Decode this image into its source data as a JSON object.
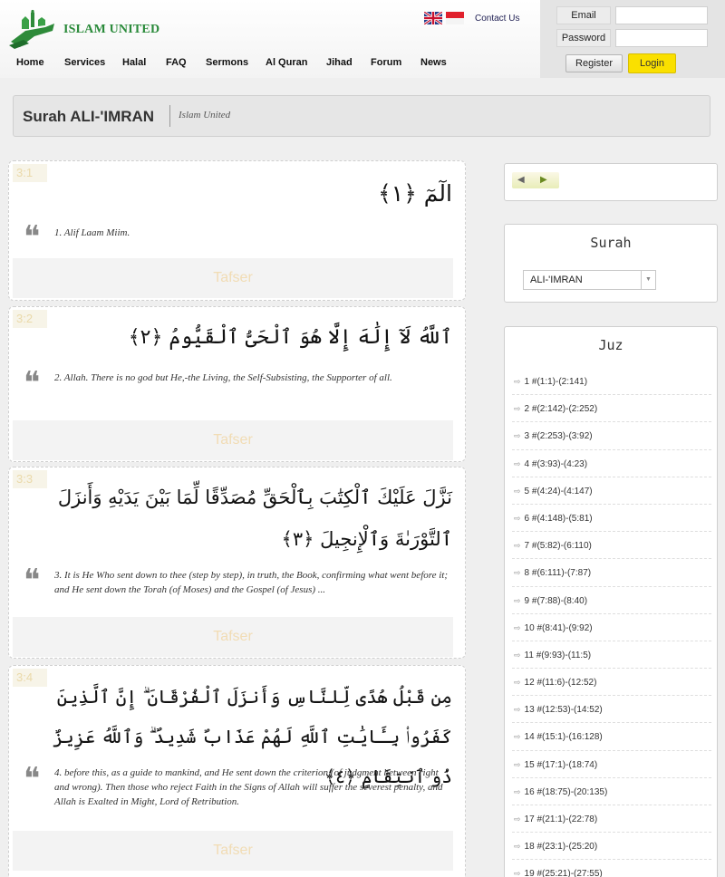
{
  "header": {
    "brand": "ISLAM UNITED",
    "contact": "Contact Us",
    "nav": [
      "Home",
      "Services",
      "Halal",
      "FAQ",
      "Sermons",
      "Al Quran",
      "Jihad",
      "Forum",
      "News"
    ]
  },
  "login": {
    "email_label": "Email",
    "password_label": "Password",
    "email_value": "",
    "password_value": "",
    "register": "Register",
    "login": "Login"
  },
  "title": {
    "main": "Surah ALI-'IMRAN",
    "sub": "Islam United"
  },
  "verses": [
    {
      "num": "3:1",
      "arabic": "الٓمٓ ﴿١﴾",
      "translation": "1. Alif Laam Miim.",
      "tafser": "Tafser"
    },
    {
      "num": "3:2",
      "arabic": "ٱللَّهُ لَآ إِلَٰهَ إِلَّا هُوَ ٱلْحَىُّ ٱلْقَيُّومُ ﴿٢﴾",
      "translation": "2. Allah. There is no god but He,-the Living, the Self-Subsisting, the Supporter of all.",
      "tafser": "Tafser"
    },
    {
      "num": "3:3",
      "arabic": "نَزَّلَ عَلَيْكَ ٱلْكِتَٰبَ بِٱلْحَقِّ مُصَدِّقًا لِّمَا بَيْنَ يَدَيْهِ وَأَنزَلَ ٱلتَّوْرَىٰةَ وَٱلْإِنجِيلَ ﴿٣﴾",
      "translation": "3. It is He Who sent down to thee (step by step), in truth, the Book, confirming what went before it; and He sent down the Torah (of Moses) and the Gospel (of Jesus) ...",
      "tafser": "Tafser"
    },
    {
      "num": "3:4",
      "arabic": "مِن قَبْلُ هُدًى لِّلنَّاسِ وَأَنزَلَ ٱلْفُرْقَانَ ۗ إِنَّ ٱلَّذِينَ كَفَرُوا۟ بِـَٔايَٰتِ ٱللَّهِ لَهُمْ عَذَابٌ شَدِيدٌ ۗ وَٱللَّهُ عَزِيزٌ ذُو ٱنتِقَامٍ ﴿٤﴾",
      "translation": "4. before this, as a guide to mankind, and He sent down the criterion (of judgment between right and wrong). Then those who reject Faith in the Signs of Allah will suffer the severest penalty, and Allah is Exalted in Might, Lord of Retribution.",
      "tafser": "Tafser"
    }
  ],
  "sidebar": {
    "surah_heading": "Surah",
    "surah_selected": "ALI-'IMRAN",
    "juz_heading": "Juz",
    "juz": [
      "1 #(1:1)-(2:141)",
      "2 #(2:142)-(2:252)",
      "3 #(2:253)-(3:92)",
      "4 #(3:93)-(4:23)",
      "5 #(4:24)-(4:147)",
      "6 #(4:148)-(5:81)",
      "7 #(5:82)-(6:110)",
      "8 #(6:111)-(7:87)",
      "9 #(7:88)-(8:40)",
      "10 #(8:41)-(9:92)",
      "11 #(9:93)-(11:5)",
      "12 #(11:6)-(12:52)",
      "13 #(12:53)-(14:52)",
      "14 #(15:1)-(16:128)",
      "15 #(17:1)-(18:74)",
      "16 #(18:75)-(20:135)",
      "17 #(21:1)-(22:78)",
      "18 #(23:1)-(25:20)",
      "19 #(25:21)-(27:55)"
    ]
  }
}
